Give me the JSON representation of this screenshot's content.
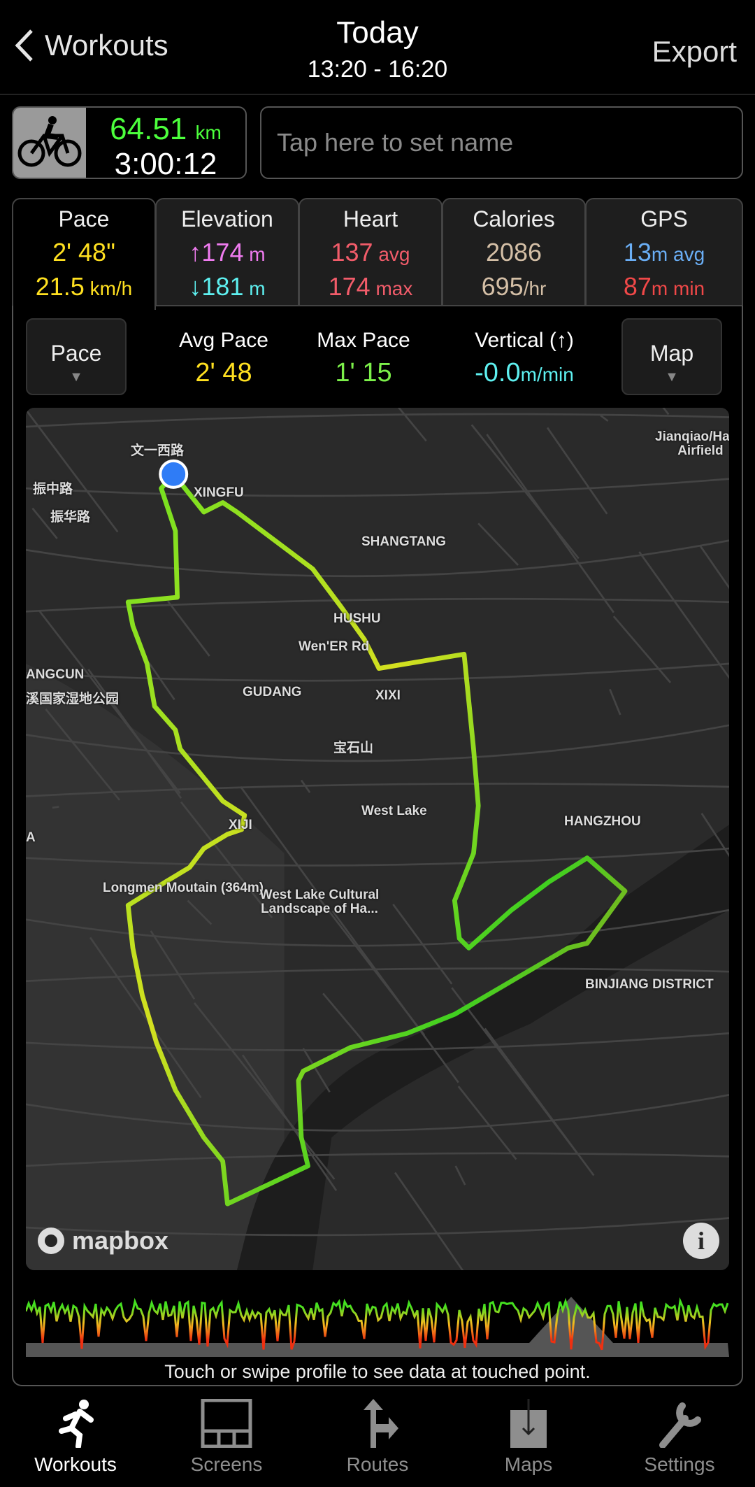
{
  "header": {
    "back_label": "Workouts",
    "title": "Today",
    "subtitle": "13:20 - 16:20",
    "export_label": "Export"
  },
  "summary": {
    "activity_icon": "bicycle-icon",
    "distance": "64.51",
    "distance_unit": "km",
    "duration": "3:00:12"
  },
  "name_field": {
    "placeholder": "Tap here to set name"
  },
  "tabs": [
    {
      "label": "Pace",
      "v1": "2' 48\"",
      "v1u": "",
      "v2": "21.5",
      "v2u": " km/h",
      "c1": "#ffe020",
      "c2": "#ffe020"
    },
    {
      "label": "Elevation",
      "v1": "↑174",
      "v1u": " m",
      "v2": "↓181",
      "v2u": " m",
      "c1": "#f07cf0",
      "c2": "#5ef0f0"
    },
    {
      "label": "Heart",
      "v1": "137",
      "v1u": " avg",
      "v2": "174",
      "v2u": " max",
      "c1": "#f25c6a",
      "c2": "#f25c6a"
    },
    {
      "label": "Calories",
      "v1": "2086",
      "v1u": "",
      "v2": "695",
      "v2u": "/hr",
      "c1": "#d4bfa6",
      "c2": "#d4bfa6"
    },
    {
      "label": "GPS",
      "v1": "13",
      "v1u": "m avg",
      "v2": "87",
      "v2u": "m min",
      "c1": "#6aaef5",
      "c2": "#f04848"
    }
  ],
  "controls": {
    "left_button": "Pace",
    "right_button": "Map",
    "metrics": [
      {
        "label": "Avg Pace",
        "value": "2' 48",
        "unit": "",
        "color": "#ffe020"
      },
      {
        "label": "Max Pace",
        "value": "1' 15",
        "unit": "",
        "color": "#7cf04a"
      },
      {
        "label": "Vertical (↑)",
        "value": "-0.0",
        "unit": "m/min",
        "color": "#5ef0f0"
      }
    ]
  },
  "map": {
    "attribution": "mapbox",
    "labels": [
      "XINGFU",
      "SHANGTANG",
      "HUSHU",
      "Wen'ER Rd",
      "GUDANG",
      "XIXI",
      "ANGCUN",
      "宝石山",
      "West Lake",
      "HANGZHOU",
      "Longmen Moutain (364m)",
      "West Lake Cultural Landscape of Ha...",
      "BINJIANG DISTRICT",
      "Jianqiao/Hang Airfield",
      "振中路",
      "振华路",
      "文一西路",
      "溪国家湿地公园",
      "XIJI",
      "A"
    ]
  },
  "profile": {
    "caption": "Touch or swipe profile to see data at touched point."
  },
  "tabbar": [
    {
      "label": "Workouts",
      "icon": "running-icon"
    },
    {
      "label": "Screens",
      "icon": "screens-icon"
    },
    {
      "label": "Routes",
      "icon": "routes-icon"
    },
    {
      "label": "Maps",
      "icon": "maps-download-icon"
    },
    {
      "label": "Settings",
      "icon": "wrench-icon"
    }
  ]
}
